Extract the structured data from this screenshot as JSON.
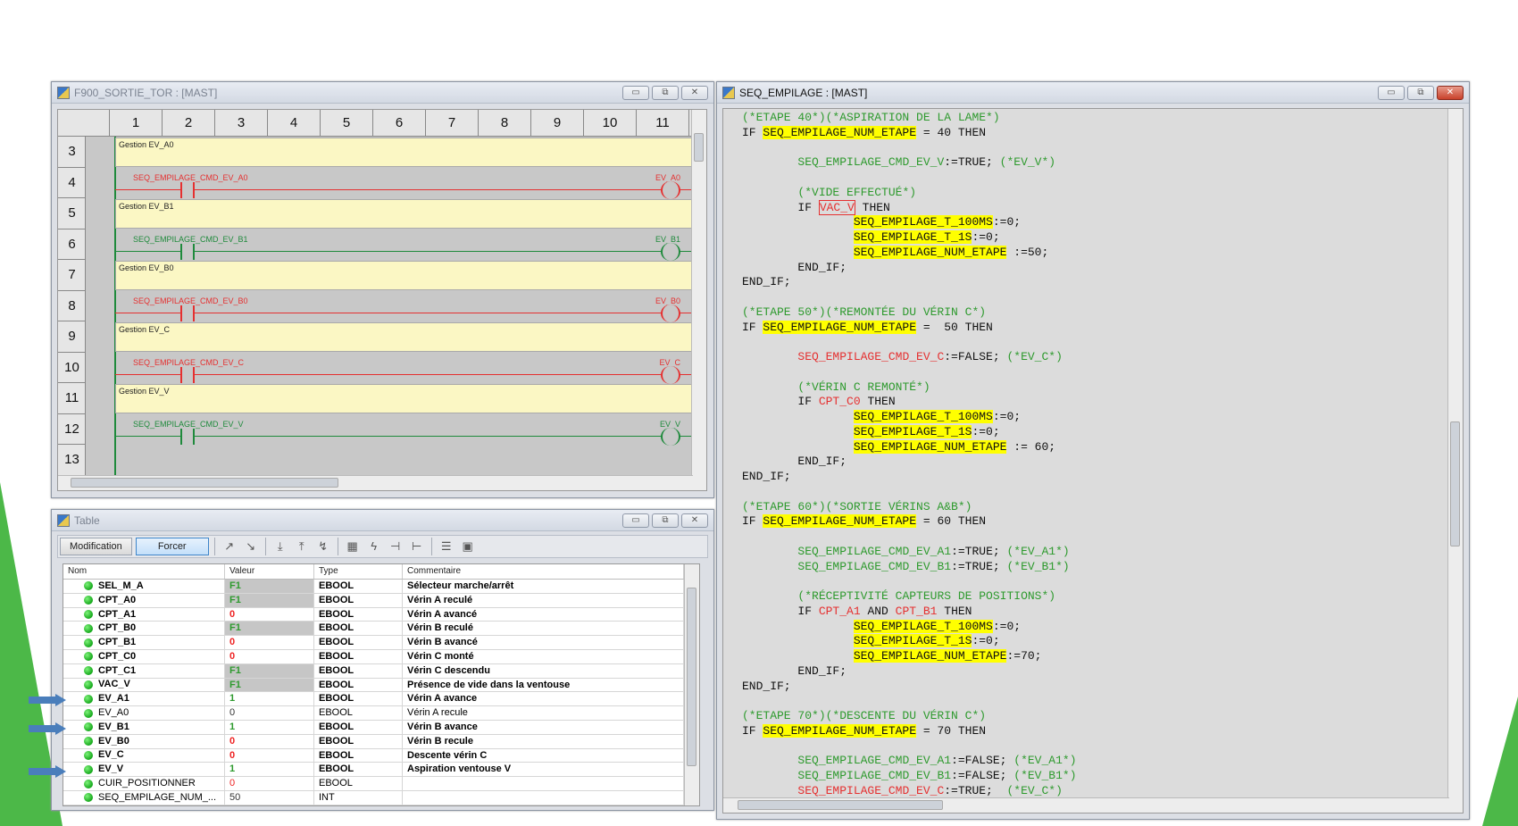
{
  "ladder_window": {
    "title": "F900_SORTIE_TOR : [MAST]",
    "columns": [
      "1",
      "2",
      "3",
      "4",
      "5",
      "6",
      "7",
      "8",
      "9",
      "10",
      "11"
    ],
    "rows": [
      "3",
      "4",
      "5",
      "6",
      "7",
      "8",
      "9",
      "10",
      "11",
      "12",
      "13"
    ],
    "rungs": [
      {
        "comment": "Gestion EV_A0",
        "contact": "SEQ_EMPILAGE_CMD_EV_A0",
        "coil": "EV_A0",
        "state": "red"
      },
      {
        "comment": "Gestion EV_B1",
        "contact": "SEQ_EMPILAGE_CMD_EV_B1",
        "coil": "EV_B1",
        "state": "green"
      },
      {
        "comment": "Gestion EV_B0",
        "contact": "SEQ_EMPILAGE_CMD_EV_B0",
        "coil": "EV_B0",
        "state": "red"
      },
      {
        "comment": "Gestion EV_C",
        "contact": "SEQ_EMPILAGE_CMD_EV_C",
        "coil": "EV_C",
        "state": "red"
      },
      {
        "comment": "Gestion EV_V",
        "contact": "SEQ_EMPILAGE_CMD_EV_V",
        "coil": "EV_V",
        "state": "green"
      }
    ]
  },
  "table_window": {
    "title": "Table",
    "toolbar": {
      "modification": "Modification",
      "forcer": "Forcer"
    },
    "headers": {
      "name": "Nom",
      "value": "Valeur",
      "type": "Type",
      "comment": "Commentaire"
    },
    "rows": [
      {
        "name": "SEL_M_A",
        "value": "F1",
        "type": "EBOOL",
        "comment": "Sélecteur marche/arrêt",
        "style": "F1",
        "bold": true
      },
      {
        "name": "CPT_A0",
        "value": "F1",
        "type": "EBOOL",
        "comment": "Vérin A reculé",
        "style": "F1",
        "bold": true
      },
      {
        "name": "CPT_A1",
        "value": "0",
        "type": "EBOOL",
        "comment": "Vérin A avancé",
        "style": "0",
        "bold": true
      },
      {
        "name": "CPT_B0",
        "value": "F1",
        "type": "EBOOL",
        "comment": "Vérin B reculé",
        "style": "F1",
        "bold": true
      },
      {
        "name": "CPT_B1",
        "value": "0",
        "type": "EBOOL",
        "comment": "Vérin B avancé",
        "style": "0",
        "bold": true
      },
      {
        "name": "CPT_C0",
        "value": "0",
        "type": "EBOOL",
        "comment": "Vérin C monté",
        "style": "0",
        "bold": true
      },
      {
        "name": "CPT_C1",
        "value": "F1",
        "type": "EBOOL",
        "comment": "Vérin C descendu",
        "style": "F1",
        "bold": true
      },
      {
        "name": "VAC_V",
        "value": "F1",
        "type": "EBOOL",
        "comment": "Présence de vide dans la ventouse",
        "style": "F1",
        "bold": true
      },
      {
        "name": "EV_A1",
        "value": "1",
        "type": "EBOOL",
        "comment": "Vérin A avance",
        "style": "1",
        "bold": true
      },
      {
        "name": "EV_A0",
        "value": "0",
        "type": "EBOOL",
        "comment": "Vérin A recule",
        "style": "n",
        "bold": false
      },
      {
        "name": "EV_B1",
        "value": "1",
        "type": "EBOOL",
        "comment": "Vérin B avance",
        "style": "1",
        "bold": true
      },
      {
        "name": "EV_B0",
        "value": "0",
        "type": "EBOOL",
        "comment": "Vérin B recule",
        "style": "0",
        "bold": true
      },
      {
        "name": "EV_C",
        "value": "0",
        "type": "EBOOL",
        "comment": "Descente vérin C",
        "style": "0",
        "bold": true
      },
      {
        "name": "EV_V",
        "value": "1",
        "type": "EBOOL",
        "comment": "Aspiration ventouse V",
        "style": "1",
        "bold": true
      },
      {
        "name": "CUIR_POSITIONNER",
        "value": "0",
        "type": "EBOOL",
        "comment": "",
        "style": "0n",
        "bold": false
      },
      {
        "name": "SEQ_EMPILAGE_NUM_...",
        "value": "50",
        "type": "INT",
        "comment": "",
        "style": "n",
        "bold": false
      }
    ]
  },
  "code_window": {
    "title": "SEQ_EMPILAGE : [MAST]",
    "lines": [
      [
        [
          "cm",
          "(*ETAPE 40*)(*ASPIRATION DE LA LAME*)"
        ]
      ],
      [
        [
          "",
          "IF "
        ],
        [
          "hl",
          "SEQ_EMPILAGE_NUM_ETAPE"
        ],
        [
          "",
          " = 40 THEN"
        ]
      ],
      [
        [
          "",
          ""
        ]
      ],
      [
        [
          "",
          "        "
        ],
        [
          "cm2",
          "SEQ_EMPILAGE_CMD_EV_V"
        ],
        [
          "",
          ":=TRUE; "
        ],
        [
          "cm",
          "(*EV_V*)"
        ]
      ],
      [
        [
          "",
          ""
        ]
      ],
      [
        [
          "",
          "        "
        ],
        [
          "cm",
          "(*VIDE EFFECTUÉ*)"
        ]
      ],
      [
        [
          "",
          "        IF "
        ],
        [
          "box",
          "VAC_V"
        ],
        [
          "",
          " THEN"
        ]
      ],
      [
        [
          "",
          "                "
        ],
        [
          "hl",
          "SEQ_EMPILAGE_T_100MS"
        ],
        [
          "",
          ":=0;"
        ]
      ],
      [
        [
          "",
          "                "
        ],
        [
          "hl",
          "SEQ_EMPILAGE_T_1S"
        ],
        [
          "",
          ":=0;"
        ]
      ],
      [
        [
          "",
          "                "
        ],
        [
          "hl",
          "SEQ_EMPILAGE_NUM_ETAPE"
        ],
        [
          "",
          " :=50;"
        ]
      ],
      [
        [
          "",
          "        END_IF;"
        ]
      ],
      [
        [
          "",
          "END_IF;"
        ]
      ],
      [
        [
          "",
          ""
        ]
      ],
      [
        [
          "cm",
          "(*ETAPE 50*)(*REMONTÉE DU VÉRIN C*)"
        ]
      ],
      [
        [
          "",
          "IF "
        ],
        [
          "hl",
          "SEQ_EMPILAGE_NUM_ETAPE"
        ],
        [
          "",
          " =  50 THEN"
        ]
      ],
      [
        [
          "",
          ""
        ]
      ],
      [
        [
          "",
          "        "
        ],
        [
          "rd",
          "SEQ_EMPILAGE_CMD_EV_C"
        ],
        [
          "",
          ":=FALSE; "
        ],
        [
          "cm",
          "(*EV_C*)"
        ]
      ],
      [
        [
          "",
          ""
        ]
      ],
      [
        [
          "",
          "        "
        ],
        [
          "cm",
          "(*VÉRIN C REMONTÉ*)"
        ]
      ],
      [
        [
          "",
          "        IF "
        ],
        [
          "rd",
          "CPT_C0"
        ],
        [
          "",
          " THEN"
        ]
      ],
      [
        [
          "",
          "                "
        ],
        [
          "hl",
          "SEQ_EMPILAGE_T_100MS"
        ],
        [
          "",
          ":=0;"
        ]
      ],
      [
        [
          "",
          "                "
        ],
        [
          "hl",
          "SEQ_EMPILAGE_T_1S"
        ],
        [
          "",
          ":=0;"
        ]
      ],
      [
        [
          "",
          "                "
        ],
        [
          "hl",
          "SEQ_EMPILAGE_NUM_ETAPE"
        ],
        [
          "",
          " := 60;"
        ]
      ],
      [
        [
          "",
          "        END_IF;"
        ]
      ],
      [
        [
          "",
          "END_IF;"
        ]
      ],
      [
        [
          "",
          ""
        ]
      ],
      [
        [
          "cm",
          "(*ETAPE 60*)(*SORTIE VÉRINS A&B*)"
        ]
      ],
      [
        [
          "",
          "IF "
        ],
        [
          "hl",
          "SEQ_EMPILAGE_NUM_ETAPE"
        ],
        [
          "",
          " = 60 THEN"
        ]
      ],
      [
        [
          "",
          ""
        ]
      ],
      [
        [
          "",
          "        "
        ],
        [
          "cm2",
          "SEQ_EMPILAGE_CMD_EV_A1"
        ],
        [
          "",
          ":=TRUE; "
        ],
        [
          "cm",
          "(*EV_A1*)"
        ]
      ],
      [
        [
          "",
          "        "
        ],
        [
          "cm2",
          "SEQ_EMPILAGE_CMD_EV_B1"
        ],
        [
          "",
          ":=TRUE; "
        ],
        [
          "cm",
          "(*EV_B1*)"
        ]
      ],
      [
        [
          "",
          ""
        ]
      ],
      [
        [
          "",
          "        "
        ],
        [
          "cm",
          "(*RÉCEPTIVITÉ CAPTEURS DE POSITIONS*)"
        ]
      ],
      [
        [
          "",
          "        IF "
        ],
        [
          "rd",
          "CPT_A1"
        ],
        [
          "",
          " AND "
        ],
        [
          "rd",
          "CPT_B1"
        ],
        [
          "",
          " THEN"
        ]
      ],
      [
        [
          "",
          "                "
        ],
        [
          "hl",
          "SEQ_EMPILAGE_T_100MS"
        ],
        [
          "",
          ":=0;"
        ]
      ],
      [
        [
          "",
          "                "
        ],
        [
          "hl",
          "SEQ_EMPILAGE_T_1S"
        ],
        [
          "",
          ":=0;"
        ]
      ],
      [
        [
          "",
          "                "
        ],
        [
          "hl",
          "SEQ_EMPILAGE_NUM_ETAPE"
        ],
        [
          "",
          ":=70;"
        ]
      ],
      [
        [
          "",
          "        END_IF;"
        ]
      ],
      [
        [
          "",
          "END_IF;"
        ]
      ],
      [
        [
          "",
          ""
        ]
      ],
      [
        [
          "cm",
          "(*ETAPE 70*)(*DESCENTE DU VÉRIN C*)"
        ]
      ],
      [
        [
          "",
          "IF "
        ],
        [
          "hl",
          "SEQ_EMPILAGE_NUM_ETAPE"
        ],
        [
          "",
          " = 70 THEN"
        ]
      ],
      [
        [
          "",
          ""
        ]
      ],
      [
        [
          "",
          "        "
        ],
        [
          "cm2",
          "SEQ_EMPILAGE_CMD_EV_A1"
        ],
        [
          "",
          ":=FALSE; "
        ],
        [
          "cm",
          "(*EV_A1*)"
        ]
      ],
      [
        [
          "",
          "        "
        ],
        [
          "cm2",
          "SEQ_EMPILAGE_CMD_EV_B1"
        ],
        [
          "",
          ":=FALSE; "
        ],
        [
          "cm",
          "(*EV_B1*)"
        ]
      ],
      [
        [
          "",
          "        "
        ],
        [
          "rd",
          "SEQ_EMPILAGE_CMD_EV_C"
        ],
        [
          "",
          ":=TRUE;  "
        ],
        [
          "cm",
          "(*EV_C*)"
        ]
      ]
    ]
  },
  "window_buttons": {
    "minimize": "▭",
    "restore": "⧉",
    "close": "✕"
  },
  "colors": {
    "green": "#1f8a3c",
    "red": "#e53030",
    "highlight": "#ffff00"
  }
}
